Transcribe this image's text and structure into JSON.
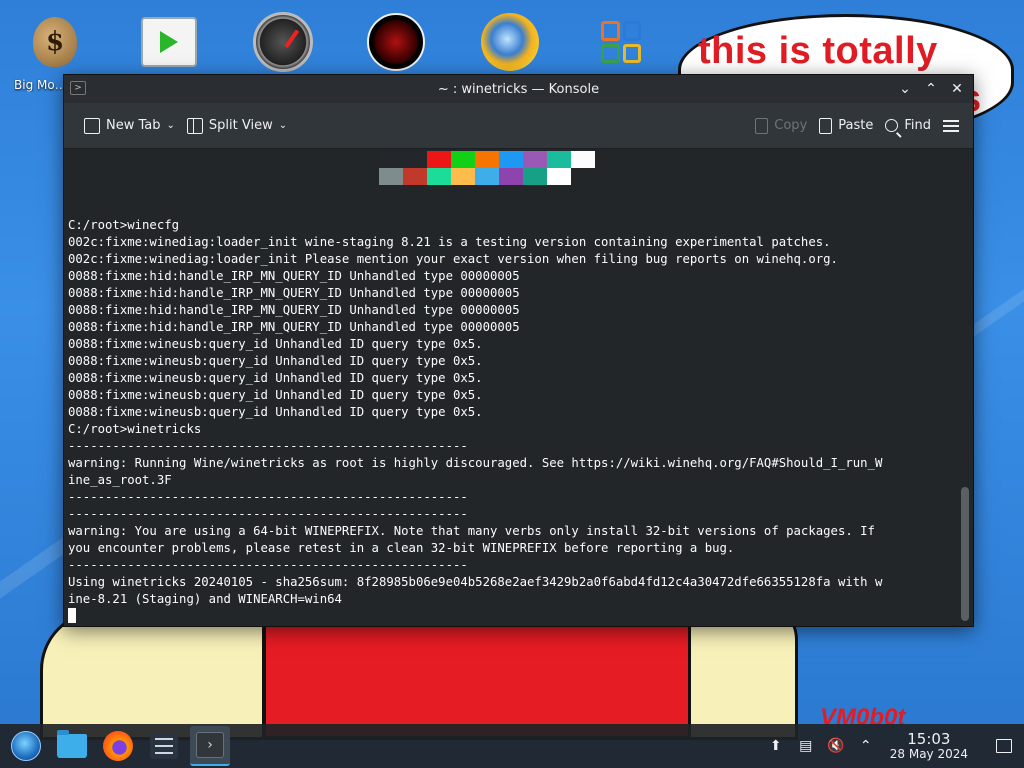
{
  "desktop": {
    "bubble_text": "this is totally",
    "bubble_fragment": "s",
    "signature": "VM0b0t",
    "icons": [
      {
        "name": "money-bag",
        "label": "Big Money Deluxe"
      },
      {
        "name": "media-player",
        "label": ""
      },
      {
        "name": "speedometer",
        "label": ""
      },
      {
        "name": "red-disc",
        "label": ""
      },
      {
        "name": "globe-sun",
        "label": ""
      },
      {
        "name": "office-tiles",
        "label": ""
      }
    ],
    "icon_label_visible": "Big Mo… Delu…"
  },
  "window": {
    "title": "~ : winetricks — Konsole",
    "buttons": {
      "minimize": "⌄",
      "maximize": "⌃",
      "close": "✕"
    }
  },
  "toolbar": {
    "new_tab": "New Tab",
    "split_view": "Split View",
    "copy": "Copy",
    "paste": "Paste",
    "find": "Find"
  },
  "terminal": {
    "palette_top": [
      "#23262b",
      "#23262b",
      "#ed1515",
      "#11d116",
      "#f67400",
      "#1d99f3",
      "#9b59b6",
      "#1abc9c",
      "#fcfcfc"
    ],
    "palette_bottom": [
      "#7f8c8d",
      "#c0392b",
      "#1cdc9a",
      "#fdbc4b",
      "#3daee9",
      "#8e44ad",
      "#16a085",
      "#ffffff"
    ],
    "lines": [
      "C:/root>winecfg",
      "002c:fixme:winediag:loader_init wine-staging 8.21 is a testing version containing experimental patches.",
      "002c:fixme:winediag:loader_init Please mention your exact version when filing bug reports on winehq.org.",
      "0088:fixme:hid:handle_IRP_MN_QUERY_ID Unhandled type 00000005",
      "0088:fixme:hid:handle_IRP_MN_QUERY_ID Unhandled type 00000005",
      "0088:fixme:hid:handle_IRP_MN_QUERY_ID Unhandled type 00000005",
      "0088:fixme:hid:handle_IRP_MN_QUERY_ID Unhandled type 00000005",
      "0088:fixme:wineusb:query_id Unhandled ID query type 0x5.",
      "0088:fixme:wineusb:query_id Unhandled ID query type 0x5.",
      "0088:fixme:wineusb:query_id Unhandled ID query type 0x5.",
      "0088:fixme:wineusb:query_id Unhandled ID query type 0x5.",
      "0088:fixme:wineusb:query_id Unhandled ID query type 0x5.",
      "C:/root>winetricks",
      "------------------------------------------------------",
      "warning: Running Wine/winetricks as root is highly discouraged. See https://wiki.winehq.org/FAQ#Should_I_run_W",
      "ine_as_root.3F",
      "------------------------------------------------------",
      "------------------------------------------------------",
      "warning: You are using a 64-bit WINEPREFIX. Note that many verbs only install 32-bit versions of packages. If",
      "you encounter problems, please retest in a clean 32-bit WINEPREFIX before reporting a bug.",
      "------------------------------------------------------",
      "Using winetricks 20240105 - sha256sum: 8f28985b06e9e04b5268e2aef3429b2a0f6abd4fd12c4a30472dfe66355128fa with w",
      "ine-8.21 (Staging) and WINEARCH=win64"
    ]
  },
  "taskbar": {
    "items": [
      "start-menu",
      "file-manager",
      "firefox",
      "system-settings",
      "konsole"
    ],
    "time": "15:03",
    "date": "28 May 2024"
  }
}
